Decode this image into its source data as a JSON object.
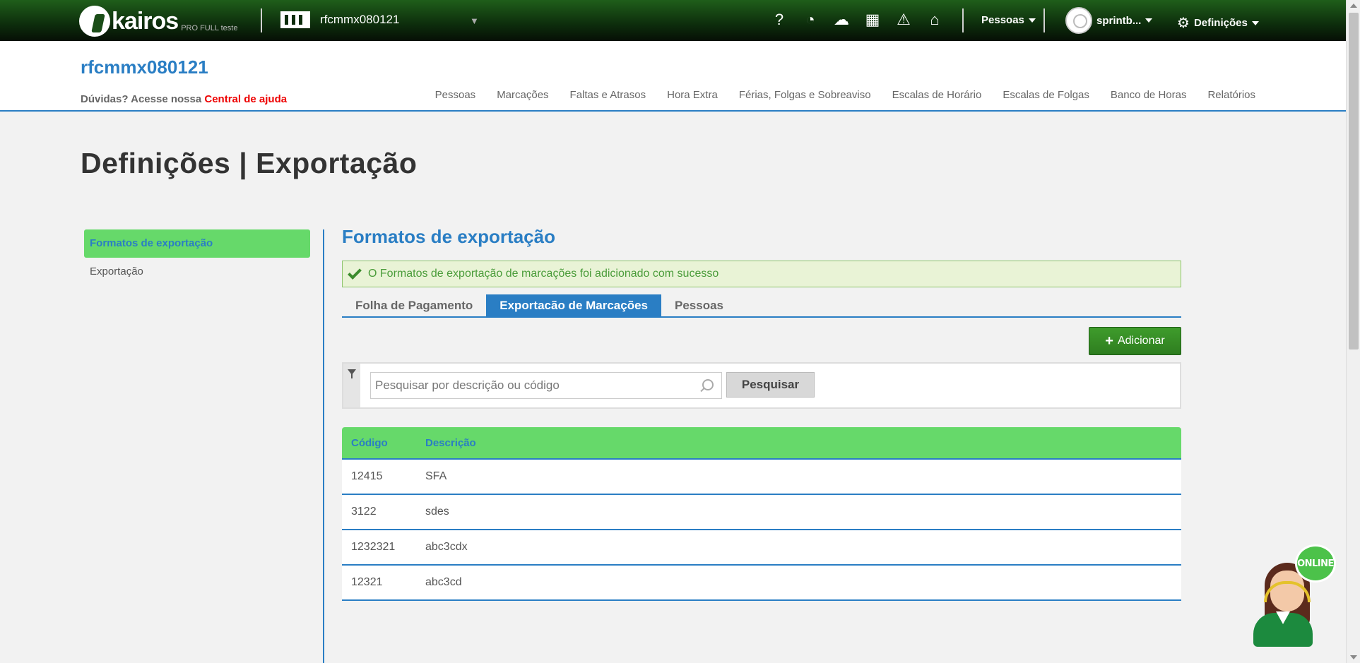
{
  "topbar": {
    "logo_word": "kairos",
    "logo_sub": "PRO FULL teste",
    "company": "rfcmmx080121",
    "company_caret": "▼",
    "icons": [
      "help-icon",
      "timer-icon",
      "cloud-upload-icon",
      "calculator-icon",
      "warning-icon",
      "inbox-icon"
    ],
    "people_menu": "Pessoas",
    "user_menu": "sprintb...",
    "settings_menu": "Definições"
  },
  "header": {
    "company_title": "rfcmmx080121",
    "help_prefix": "Dúvidas? Acesse nossa",
    "help_link": "Central de ajuda",
    "nav": [
      "Pessoas",
      "Marcações",
      "Faltas e Atrasos",
      "Hora Extra",
      "Férias, Folgas e Sobreaviso",
      "Escalas de Horário",
      "Escalas de Folgas",
      "Banco de Horas",
      "Relatórios"
    ]
  },
  "page_title": "Definições | Exportação",
  "sidebar": {
    "items": [
      {
        "label": "Formatos de exportação",
        "active": true
      },
      {
        "label": "Exportação",
        "active": false
      }
    ]
  },
  "main": {
    "title": "Formatos de exportação",
    "alert": "O Formatos de exportação de marcações foi adicionado com sucesso",
    "tabs": [
      {
        "label": "Folha de Pagamento",
        "active": false
      },
      {
        "label": "Exportacão de Marcações",
        "active": true
      },
      {
        "label": "Pessoas",
        "active": false
      }
    ],
    "add_label": "Adicionar",
    "search": {
      "placeholder": "Pesquisar por descrição ou código",
      "value": "",
      "button": "Pesquisar"
    },
    "table": {
      "headers": [
        "Código",
        "Descrição"
      ],
      "rows": [
        [
          "12415",
          "SFA"
        ],
        [
          "3122",
          "sdes"
        ],
        [
          "1232321",
          "abc3cdx"
        ],
        [
          "12321",
          "abc3cd"
        ]
      ]
    }
  },
  "chat": {
    "status": "ONLINE"
  },
  "colors": {
    "accent": "#2a7ec4",
    "green": "#66d96a",
    "topbar": "#0d2d0c",
    "alert_bg": "#e9f3d6"
  }
}
